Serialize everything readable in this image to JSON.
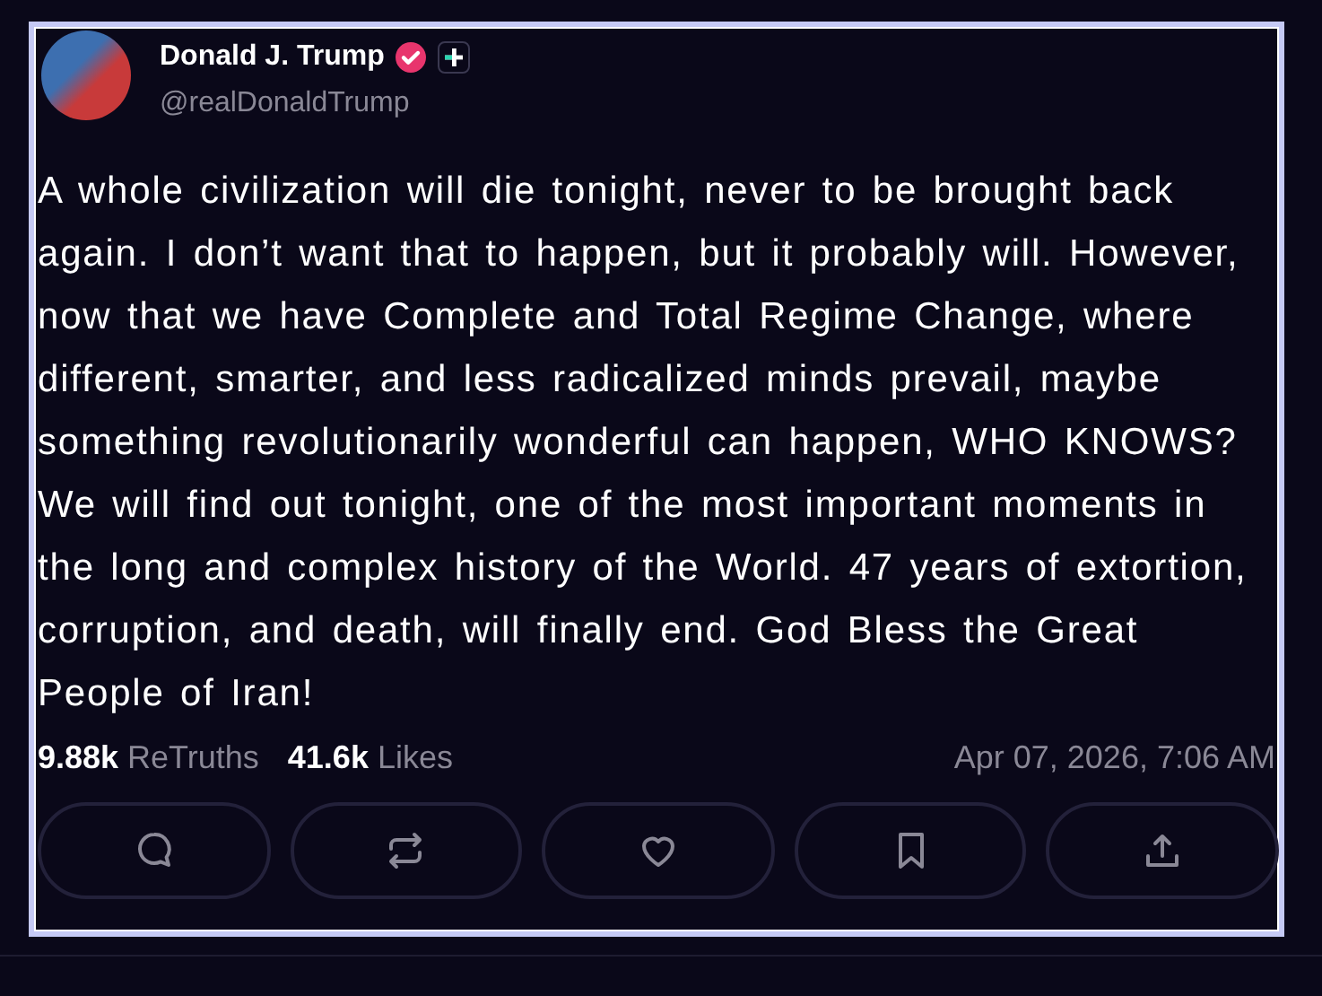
{
  "post": {
    "author": {
      "name": "Donald J. Trump",
      "handle": "@realDonaldTrump",
      "verified": true,
      "plus_badge": true
    },
    "text": "A whole civilization will die tonight, never to be brought back again. I don’t want that to happen, but it probably will. However, now that we have Complete and Total Regime Change, where different, smarter, and less radicalized minds prevail, maybe something revolutionarily wonderful can happen, WHO KNOWS? We will find out tonight, one of the most important moments in the long and complex history of the World. 47 years of extortion, corruption, and death, will finally end. God Bless the Great People of Iran!",
    "stats": [
      {
        "count": "9.88k",
        "label": "ReTruths"
      },
      {
        "count": "41.6k",
        "label": "Likes"
      }
    ],
    "timestamp": "Apr 07, 2026, 7:06 AM",
    "actions": [
      {
        "kind": "reply"
      },
      {
        "kind": "retruth"
      },
      {
        "kind": "like"
      },
      {
        "kind": "bookmark"
      },
      {
        "kind": "share"
      }
    ]
  }
}
